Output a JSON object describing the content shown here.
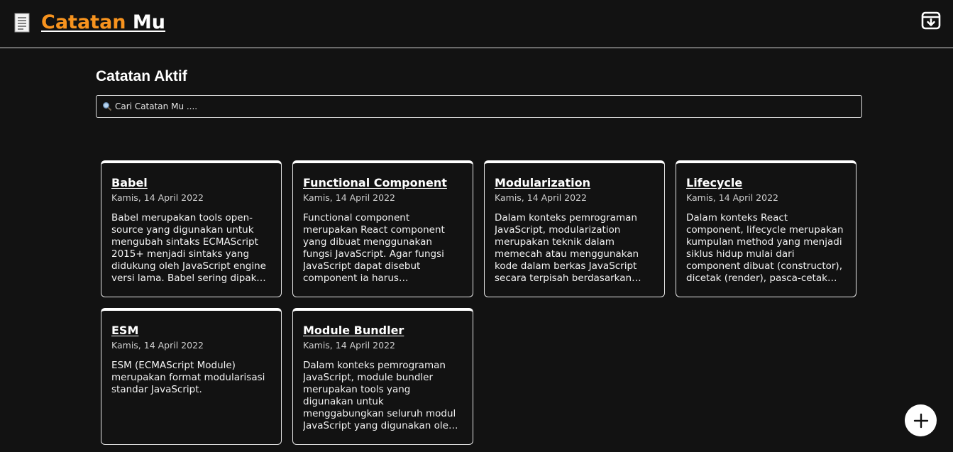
{
  "header": {
    "brand_accent": "Catatan",
    "brand_rest": " Mu",
    "brand_icon": "note-icon",
    "archive_icon": "archive-icon"
  },
  "main": {
    "title": "Catatan Aktif",
    "search": {
      "placeholder": "Cari Catatan Mu ....",
      "value": ""
    }
  },
  "notes": [
    {
      "title": "Babel",
      "date": "Kamis, 14 April 2022",
      "body": "Babel merupakan tools open-source yang digunakan untuk mengubah sintaks ECMAScript 2015+ menjadi sintaks yang didukung oleh JavaScript engine versi lama. Babel sering dipakai ketika kita menggunakan sintaks terbaru termasuk sintaks JSX."
    },
    {
      "title": "Functional Component",
      "date": "Kamis, 14 April 2022",
      "body": "Functional component merupakan React component yang dibuat menggunakan fungsi JavaScript. Agar fungsi JavaScript dapat disebut component ia harus mengembalikan React element dan dipanggil layaknya React component."
    },
    {
      "title": "Modularization",
      "date": "Kamis, 14 April 2022",
      "body": "Dalam konteks pemrograman JavaScript, modularization merupakan teknik dalam memecah atau menggunakan kode dalam berkas JavaScript secara terpisah berdasarkan tanggung jawabnya masing-masing."
    },
    {
      "title": "Lifecycle",
      "date": "Kamis, 14 April 2022",
      "body": "Dalam konteks React component, lifecycle merupakan kumpulan method yang menjadi siklus hidup mulai dari component dibuat (constructor), dicetak (render), pasca-cetak (componentDidMount), dan sebagainya."
    },
    {
      "title": "ESM",
      "date": "Kamis, 14 April 2022",
      "body": "ESM (ECMAScript Module) merupakan format modularisasi standar JavaScript."
    },
    {
      "title": "Module Bundler",
      "date": "Kamis, 14 April 2022",
      "body": "Dalam konteks pemrograman JavaScript, module bundler merupakan tools yang digunakan untuk menggabungkan seluruh modul JavaScript yang digunakan oleh aplikasi menjadi satu berkas."
    }
  ],
  "fab": {
    "icon": "plus-icon"
  },
  "colors": {
    "background": "#121212",
    "accent": "#f7931e",
    "text": "#ffffff"
  }
}
